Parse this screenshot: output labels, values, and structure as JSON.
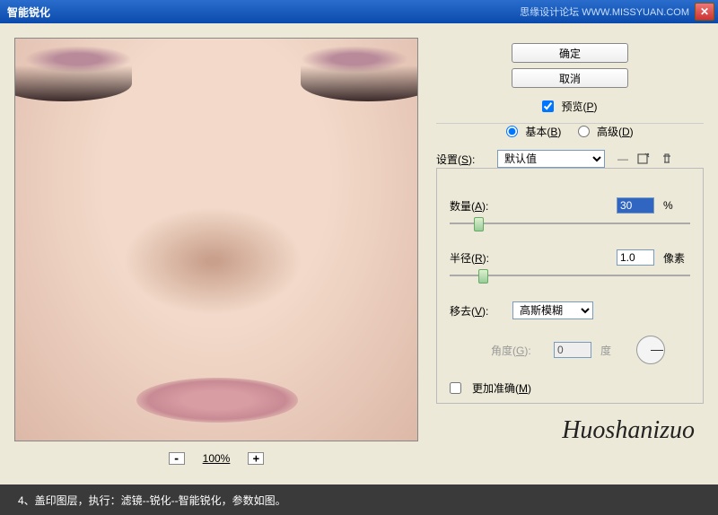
{
  "titlebar": {
    "title": "智能锐化",
    "watermark": "思缘设计论坛 WWW.MISSYUAN.COM"
  },
  "zoom": {
    "value": "100%",
    "minus": "-",
    "plus": "+"
  },
  "buttons": {
    "ok": "确定",
    "cancel": "取消"
  },
  "preview": {
    "label": "预览(",
    "key": "P",
    "close": ")"
  },
  "mode": {
    "basic": "基本(",
    "basic_key": "B",
    "advanced": "高级(",
    "advanced_key": "D",
    "close": ")"
  },
  "settings": {
    "label": "设置(",
    "key": "S",
    "close": "):",
    "value": "默认值",
    "dash": "—"
  },
  "params": {
    "amount": {
      "label": "数量(",
      "key": "A",
      "close": "):",
      "value": "30",
      "unit": "%"
    },
    "radius": {
      "label": "半径(",
      "key": "R",
      "close": "):",
      "value": "1.0",
      "unit": "像素"
    },
    "remove": {
      "label": "移去(",
      "key": "V",
      "close": "):",
      "value": "高斯模糊"
    },
    "angle": {
      "label": "角度(",
      "key": "G",
      "close": "):",
      "value": "0",
      "unit": "度"
    },
    "accurate": {
      "label": "更加准确(",
      "key": "M",
      "close": ")"
    }
  },
  "signature": "Huoshanizuo",
  "footer": "4、盖印图层，执行：滤镜--锐化--智能锐化，参数如图。"
}
